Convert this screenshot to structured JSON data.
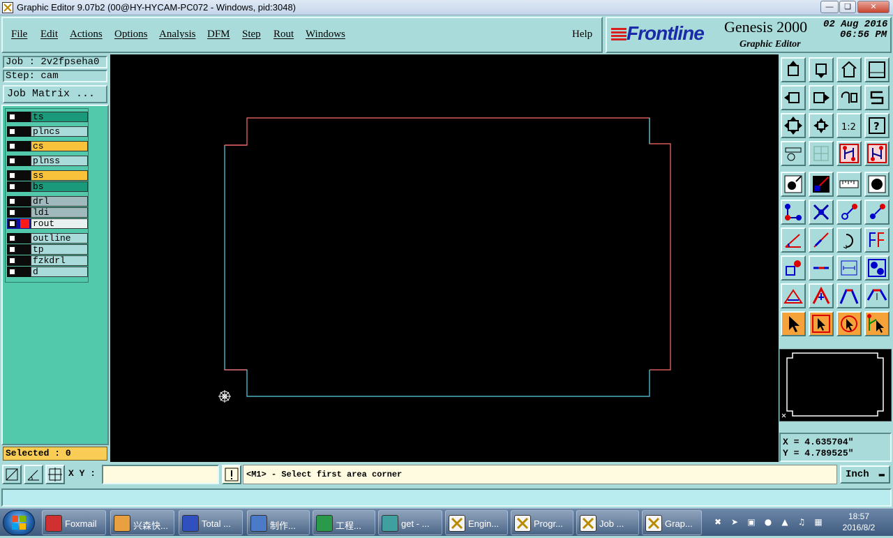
{
  "window": {
    "title": "Graphic Editor 9.07b2 (00@HY-HYCAM-PC072 - Windows, pid:3048)"
  },
  "menu": {
    "items": [
      "File",
      "Edit",
      "Actions",
      "Options",
      "Analysis",
      "DFM",
      "Step",
      "Rout",
      "Windows"
    ],
    "help": "Help"
  },
  "brand": {
    "logo": "Frontline",
    "product": "Genesis 2000",
    "subtitle": "Graphic Editor",
    "date": "02 Aug 2016",
    "time": "06:56 PM"
  },
  "job": {
    "job_label": "Job : 2v2fpseha0",
    "step_label": "Step: cam",
    "matrix_button": "Job Matrix ..."
  },
  "layers": [
    {
      "name": "ts",
      "color": "#1a9a7a",
      "checked": false,
      "active": false
    },
    {
      "name": "plncs",
      "color": "#a9dbdb",
      "checked": false,
      "active": false
    },
    {
      "name": "cs",
      "color": "#f8c23a",
      "checked": false,
      "active": false
    },
    {
      "name": "plnss",
      "color": "#a9dbdb",
      "checked": false,
      "active": false
    },
    {
      "name": "ss",
      "color": "#f8c23a",
      "checked": false,
      "active": false
    },
    {
      "name": "bs",
      "color": "#1a9a7a",
      "checked": false,
      "active": false
    },
    {
      "name": "drl",
      "color": "#9fb9bd",
      "checked": false,
      "active": false
    },
    {
      "name": "ldi",
      "color": "#9fb9bd",
      "checked": false,
      "active": false
    },
    {
      "name": "rout",
      "color": "#a9dbdb",
      "checked": true,
      "active": true
    },
    {
      "name": "outline",
      "color": "#a9dbdb",
      "checked": false,
      "active": false
    },
    {
      "name": "tp",
      "color": "#a9dbdb",
      "checked": false,
      "active": false
    },
    {
      "name": "fzkdrl",
      "color": "#a9dbdb",
      "checked": false,
      "active": false
    },
    {
      "name": "d",
      "color": "#a9dbdb",
      "checked": false,
      "active": false
    }
  ],
  "selected_label": "Selected : 0",
  "coords": {
    "x": "X = 4.635704\"",
    "y": "Y = 4.789525\""
  },
  "cmd": {
    "xy_label": "X Y :",
    "xy_value": "",
    "prompt": "<M1> - Select first area corner",
    "unit": "Inch"
  },
  "taskbar": {
    "tasks": [
      {
        "label": "Foxmail",
        "icon": "foxmail-icon",
        "color": "#d03030"
      },
      {
        "label": "兴森快...",
        "icon": "shell-icon",
        "color": "#e8a040"
      },
      {
        "label": "Total ...",
        "icon": "floppy-icon",
        "color": "#3050c0"
      },
      {
        "label": "制作...",
        "icon": "document-icon",
        "color": "#4a7ac8"
      },
      {
        "label": "工程...",
        "icon": "f-logo-icon",
        "color": "#2a9a4a"
      },
      {
        "label": "get - ...",
        "icon": "eye-icon",
        "color": "#40a0a0"
      },
      {
        "label": "Engin...",
        "icon": "genesis-icon",
        "color": "#f4f4f4"
      },
      {
        "label": "Progr...",
        "icon": "genesis-icon",
        "color": "#f4f4f4"
      },
      {
        "label": "Job ...",
        "icon": "genesis-icon",
        "color": "#f4f4f4"
      },
      {
        "label": "Grap...",
        "icon": "genesis-icon",
        "color": "#f4f4f4"
      }
    ],
    "clock_time": "18:57",
    "clock_date": "2016/8/2"
  }
}
